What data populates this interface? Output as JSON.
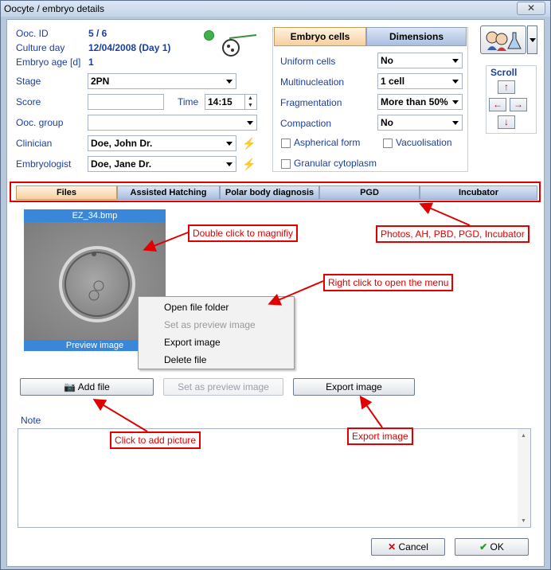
{
  "window": {
    "title": "Oocyte / embryo details",
    "close_label": "✕"
  },
  "header": {
    "ooc_id_label": "Ooc. ID",
    "ooc_id_value": "5  /  6",
    "culture_day_label": "Culture day",
    "culture_day_value": "12/04/2008  (Day 1)",
    "embryo_age_label": "Embryo age [d]",
    "embryo_age_value": "1"
  },
  "form": {
    "stage_label": "Stage",
    "stage_value": "2PN",
    "score_label": "Score",
    "score_value": "",
    "time_label": "Time",
    "time_value": "14:15",
    "ooc_group_label": "Ooc. group",
    "ooc_group_value": "",
    "clinician_label": "Clinician",
    "clinician_value": "Doe, John Dr.",
    "embryologist_label": "Embryologist",
    "embryologist_value": "Doe, Jane Dr."
  },
  "right_tabs": {
    "embryo_cells": "Embryo cells",
    "dimensions": "Dimensions"
  },
  "embryo_cells": {
    "uniform_label": "Uniform cells",
    "uniform_value": "No",
    "multinucleation_label": "Multinucleation",
    "multinucleation_value": "1 cell",
    "fragmentation_label": "Fragmentation",
    "fragmentation_value": "More than 50%",
    "compaction_label": "Compaction",
    "compaction_value": "No",
    "aspherical_label": "Aspherical form",
    "vacuolisation_label": "Vacuolisation",
    "granular_label": "Granular cytoplasm"
  },
  "scroll": {
    "label": "Scroll"
  },
  "tabs": [
    "Files",
    "Assisted Hatching",
    "Polar body diagnosis",
    "PGD",
    "Incubator"
  ],
  "image": {
    "filename": "EZ_34.bmp",
    "footer": "Preview image"
  },
  "context_menu": [
    "Open file folder",
    "Set as preview image",
    "Export image",
    "Delete file"
  ],
  "buttons": {
    "add_file": "Add file",
    "set_preview": "Set as preview image",
    "export": "Export image",
    "cancel": "Cancel",
    "ok": "OK"
  },
  "note_label": "Note",
  "callouts": {
    "magnify": "Double click to magnifiy",
    "tabs": "Photos, AH, PBD, PGD, Incubator",
    "right_click": "Right click to open the menu",
    "add_picture": "Click to add picture",
    "export": "Export image"
  },
  "colors": {
    "label_blue": "#1a3fa0",
    "annotation_red": "#e00000",
    "status_green": "#3fb24a"
  }
}
